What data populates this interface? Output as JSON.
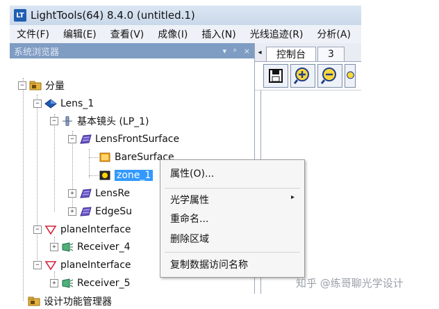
{
  "window": {
    "title": "LightTools(64) 8.4.0  (untitled.1)",
    "logo_text": "LT"
  },
  "menubar": [
    {
      "label": "文件(F)"
    },
    {
      "label": "编辑(E)"
    },
    {
      "label": "查看(V)"
    },
    {
      "label": "成像(I)"
    },
    {
      "label": "插入(N)"
    },
    {
      "label": "光线追迹(R)"
    },
    {
      "label": "分析(A)"
    }
  ],
  "browser": {
    "title": "系统浏览器",
    "controls": [
      "▾",
      "ᵖ",
      "×"
    ],
    "tree": [
      {
        "label": "分量"
      },
      {
        "label": "Lens_1"
      },
      {
        "label": "基本镜头 (LP_1)"
      },
      {
        "label": "LensFrontSurface"
      },
      {
        "label": "BareSurface"
      },
      {
        "label": "zone_1"
      },
      {
        "label": "LensRe"
      },
      {
        "label": "EdgeSu"
      },
      {
        "label": "planeInterface"
      },
      {
        "label": "Receiver_4"
      },
      {
        "label": "planeInterface"
      },
      {
        "label": "Receiver_5"
      },
      {
        "label": "设计功能管理器"
      }
    ]
  },
  "right_panel": {
    "tab_arrow": "◂",
    "tabs": [
      {
        "label": "控制台"
      },
      {
        "label": "3"
      }
    ]
  },
  "context_menu": {
    "items": [
      {
        "label": "属性(O)..."
      },
      {
        "label": "光学属性"
      },
      {
        "label": "重命名..."
      },
      {
        "label": "删除区域"
      },
      {
        "label": "复制数据访问名称"
      }
    ],
    "submenu_arrow": "▸"
  },
  "watermark": "知乎 @练哥聊光学设计"
}
